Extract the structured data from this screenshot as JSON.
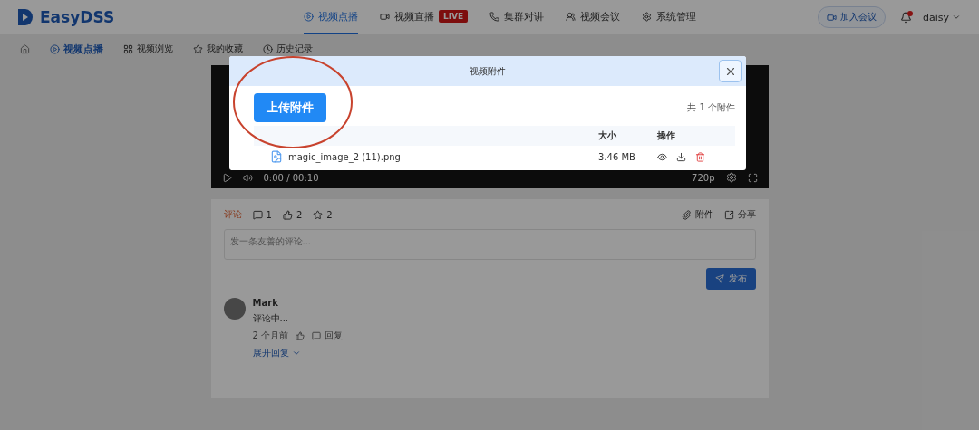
{
  "header": {
    "logo": "EasyDSS",
    "nav": [
      {
        "label": "视频点播",
        "selected": true
      },
      {
        "label": "视频直播",
        "selected": false,
        "badge": "LIVE"
      },
      {
        "label": "集群对讲",
        "selected": false
      },
      {
        "label": "视频会议",
        "selected": false
      },
      {
        "label": "系统管理",
        "selected": false
      }
    ],
    "join_button": "加入会议",
    "notification_dot": true,
    "user": "daisy"
  },
  "subnav": {
    "items": [
      {
        "label": "视频点播",
        "selected": true
      },
      {
        "label": "视频浏览",
        "selected": false
      },
      {
        "label": "我的收藏",
        "selected": false
      },
      {
        "label": "历史记录",
        "selected": false
      }
    ]
  },
  "video": {
    "time": "0:00 / 00:10",
    "quality": "720p"
  },
  "comments": {
    "tab": "评论",
    "counts": [
      {
        "kind": "comments",
        "value": "1"
      },
      {
        "kind": "likes",
        "value": "2"
      },
      {
        "kind": "favorites",
        "value": "2"
      }
    ],
    "actions": [
      {
        "kind": "attachment",
        "label": "附件"
      },
      {
        "kind": "share",
        "label": "分享"
      }
    ],
    "input": {
      "placeholder": "发一条友善的评论..."
    },
    "post_button": "发布",
    "items": [
      {
        "author": "Mark",
        "text": "评论中...",
        "time": "2 个月前",
        "reply": "回复",
        "expand": "展开回复"
      }
    ]
  },
  "modal": {
    "title": "视频附件",
    "upload_button": "上传附件",
    "count": "共 1 个附件",
    "columns": [
      "大小",
      "操作"
    ],
    "rows": [
      {
        "name": "magic_image_2 (11).png",
        "size": "3.46 MB"
      }
    ]
  }
}
